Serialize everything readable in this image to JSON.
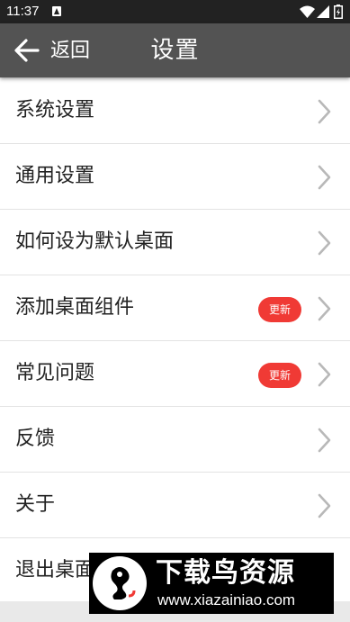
{
  "status_bar": {
    "time": "11:37",
    "icons": [
      "notification-icon",
      "wifi-icon",
      "signal-icon",
      "battery-icon"
    ]
  },
  "app_bar": {
    "back_label": "返回",
    "title": "设置",
    "background": "#535353"
  },
  "settings": {
    "items": [
      {
        "label": "系统设置"
      },
      {
        "label": "通用设置"
      },
      {
        "label": "如何设为默认桌面"
      },
      {
        "label": "添加桌面组件",
        "badge": "更新"
      },
      {
        "label": "常见问题",
        "badge": "更新"
      },
      {
        "label": "反馈"
      },
      {
        "label": "关于"
      },
      {
        "label": "退出桌面"
      }
    ],
    "badge_color": "#f03a35",
    "chevron_icon": "chevron-right-icon"
  },
  "watermark": {
    "name": "下载鸟资源",
    "url": "www.xiazainiao.com"
  }
}
